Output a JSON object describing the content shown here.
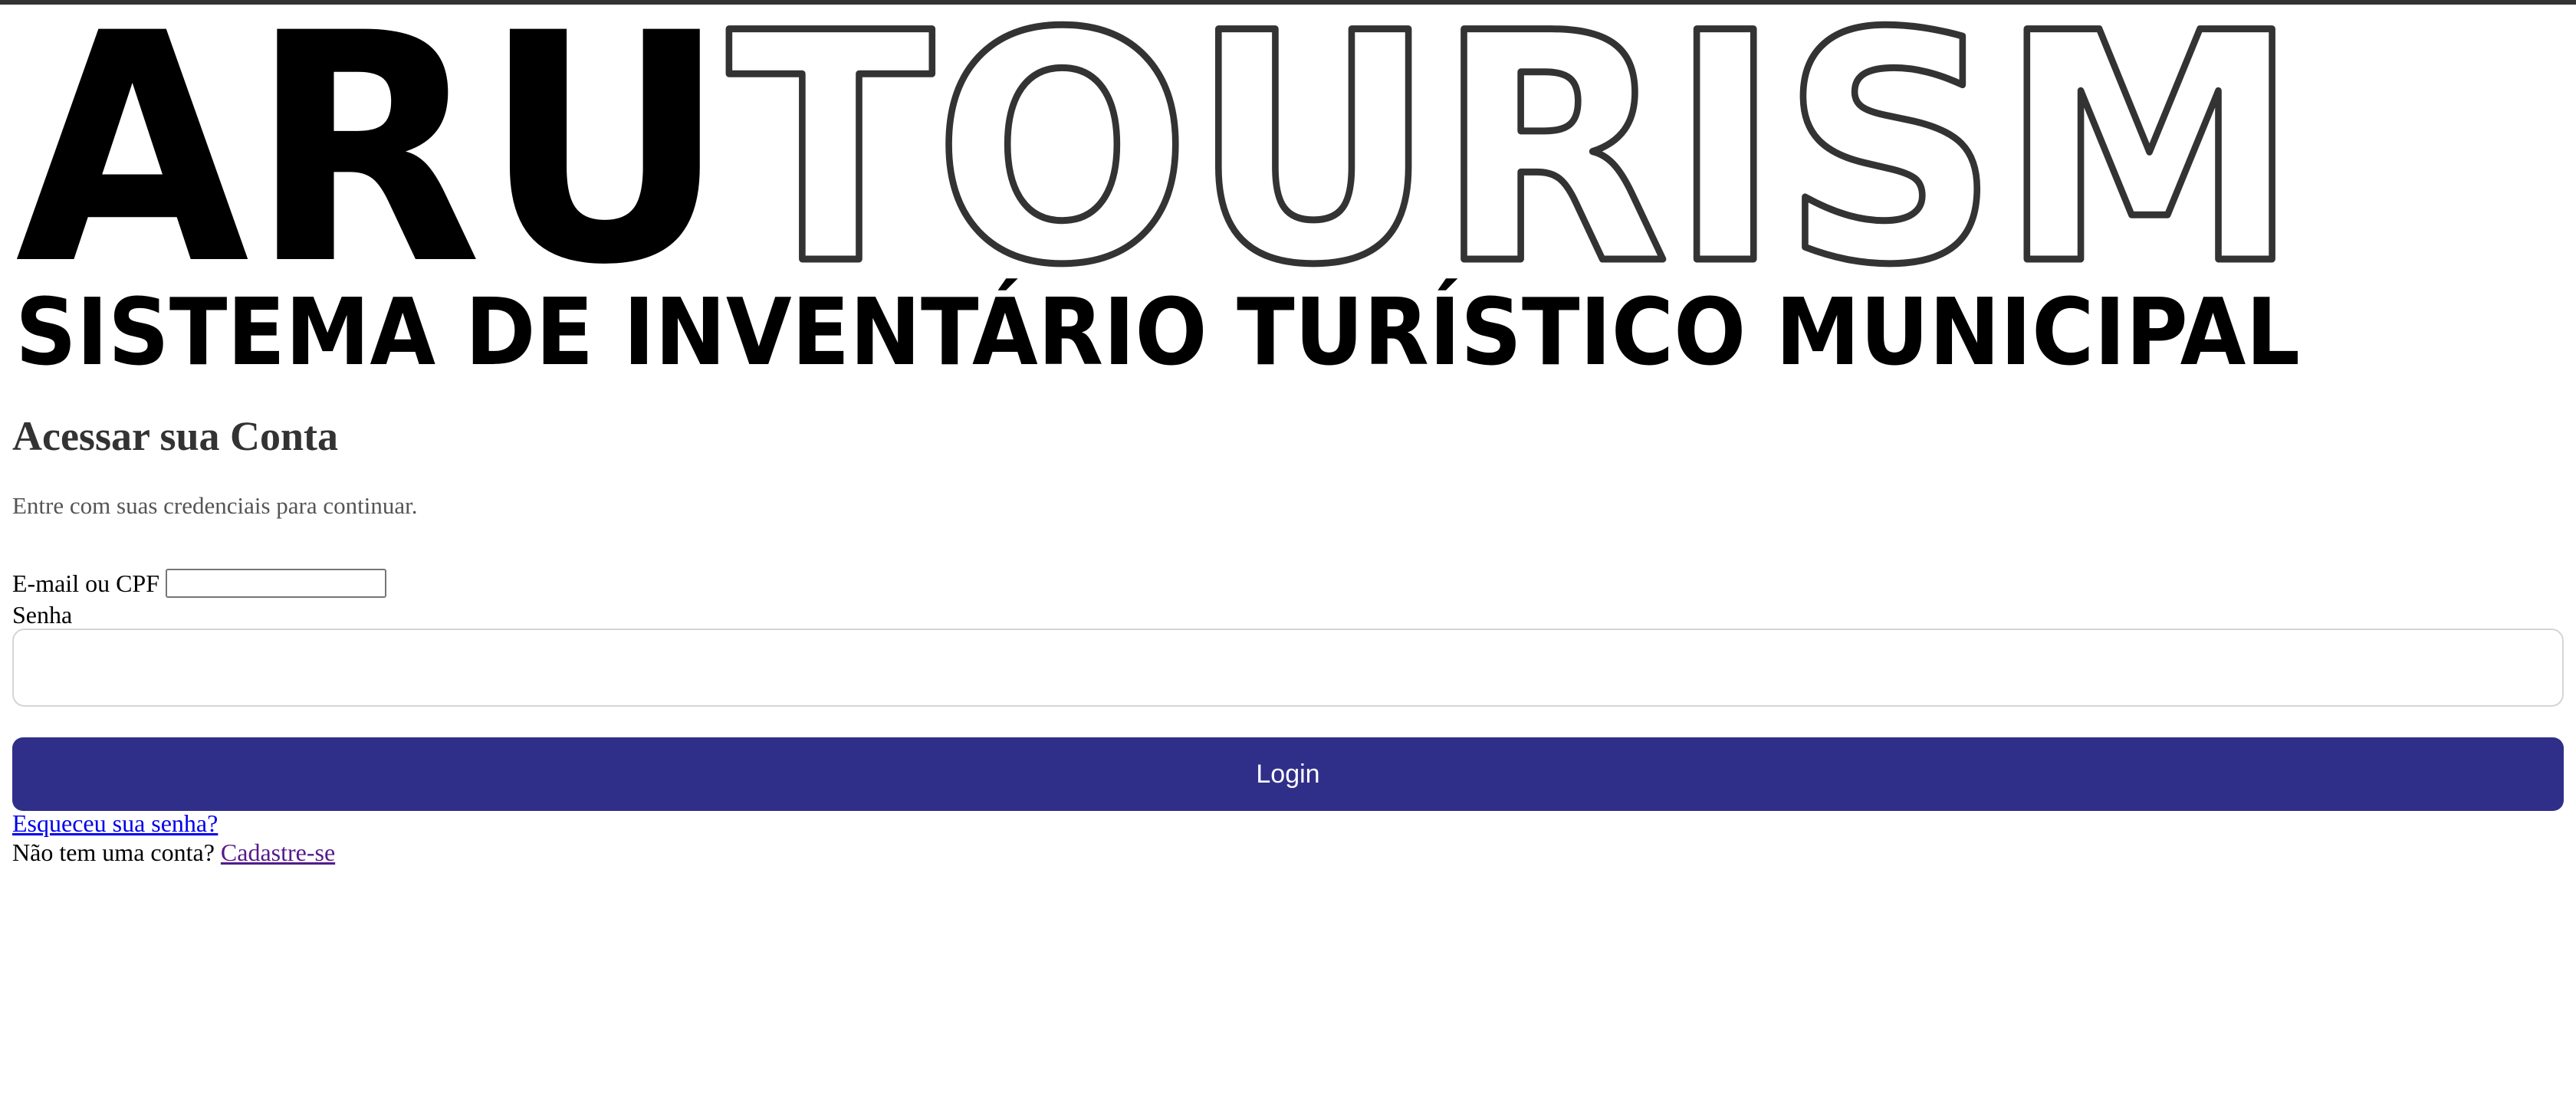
{
  "logo": {
    "brand_bold": "ARU",
    "brand_outline": "TOURISM",
    "tagline": "SISTEMA DE INVENTÁRIO TURÍSTICO MUNICIPAL"
  },
  "login": {
    "title": "Acessar sua Conta",
    "subtitle": "Entre com suas credenciais para continuar.",
    "email_label": "E-mail ou CPF",
    "email_value": "",
    "password_label": "Senha",
    "password_value": "",
    "submit_label": "Login",
    "forgot_password": "Esqueceu sua senha?",
    "no_account_text": "Não tem uma conta?",
    "signup_link": "Cadastre-se"
  },
  "colors": {
    "primary_button": "#2f2f8a",
    "title_text": "#333333",
    "link_unvisited": "#0000ee",
    "link_visited": "#551a8b"
  }
}
